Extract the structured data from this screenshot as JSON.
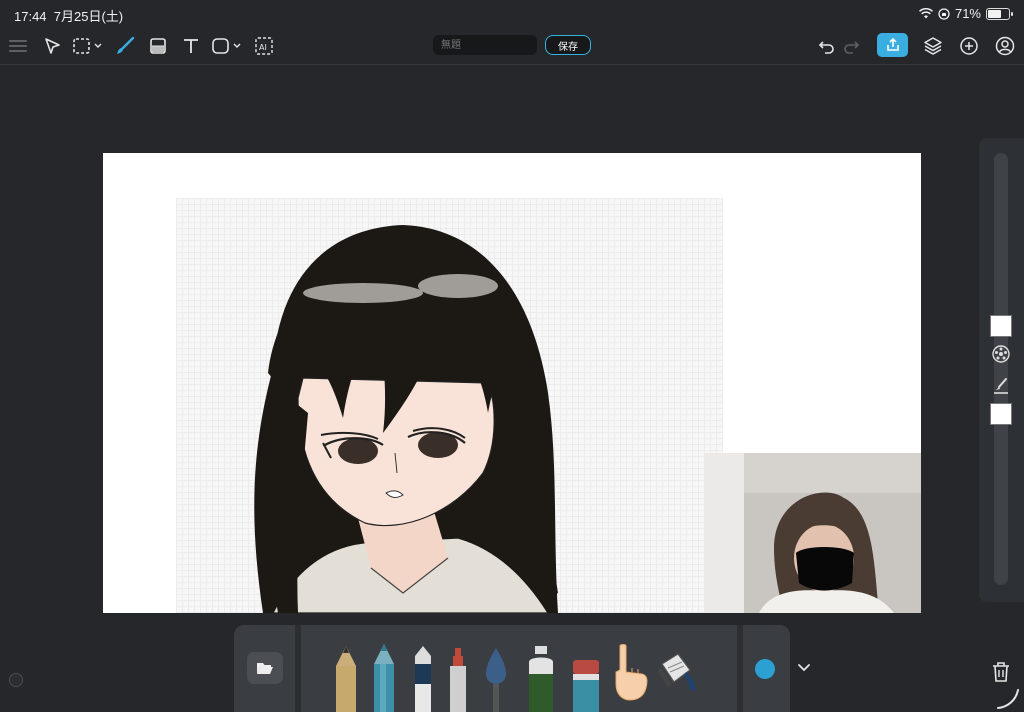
{
  "status": {
    "time": "17:44",
    "date": "7月25日(土)",
    "battery": "71%",
    "battery_level": 0.71
  },
  "toolbar": {
    "title_placeholder": "無題",
    "title_value": "",
    "save_label": "保存",
    "icons": [
      "menu-icon",
      "select-arrow-icon",
      "marquee-select-icon",
      "brush-icon",
      "fill-icon",
      "text-icon",
      "shape-icon",
      "ai-icon",
      "undo-icon",
      "redo-icon",
      "share-icon",
      "layers-icon",
      "add-icon",
      "account-icon"
    ]
  },
  "colors": {
    "accent": "#3aaee0",
    "background": "#25272a",
    "current_color": "#2ba0d1"
  },
  "dock": {
    "tools": [
      "pencil",
      "colored-pencil",
      "marker",
      "pen",
      "watercolor-brush",
      "spray-can",
      "eraser",
      "finger-smudge",
      "bucket"
    ]
  }
}
